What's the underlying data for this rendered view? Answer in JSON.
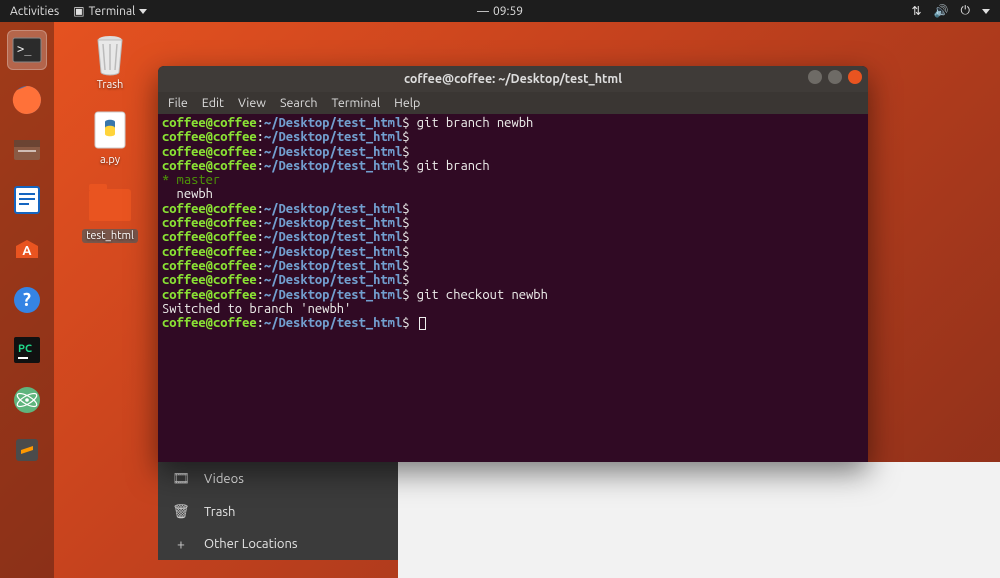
{
  "topbar": {
    "activities": "Activities",
    "app_name": "Terminal",
    "clock": "09:59",
    "clock_prefix": "—"
  },
  "desktop": {
    "trash": "Trash",
    "apy": "a.py",
    "folder": "test_html"
  },
  "nautilus": {
    "videos": "Videos",
    "trash": "Trash",
    "other": "Other Locations"
  },
  "terminal": {
    "title": "coffee@coffee: ~/Desktop/test_html",
    "menu": {
      "file": "File",
      "edit": "Edit",
      "view": "View",
      "search": "Search",
      "terminal": "Terminal",
      "help": "Help"
    },
    "prompt": {
      "user": "coffee@coffee",
      "sep": ":",
      "path": "~/Desktop/test_html",
      "sym": "$"
    },
    "lines": [
      {
        "type": "cmd",
        "text": " git branch newbh"
      },
      {
        "type": "cmd",
        "text": ""
      },
      {
        "type": "cmd",
        "text": ""
      },
      {
        "type": "cmd",
        "text": " git branch"
      },
      {
        "type": "out_master",
        "text": "* master"
      },
      {
        "type": "out",
        "text": "  newbh"
      },
      {
        "type": "cmd",
        "text": ""
      },
      {
        "type": "cmd",
        "text": ""
      },
      {
        "type": "cmd",
        "text": ""
      },
      {
        "type": "cmd",
        "text": ""
      },
      {
        "type": "cmd",
        "text": ""
      },
      {
        "type": "cmd",
        "text": ""
      },
      {
        "type": "cmd",
        "text": " git checkout newbh"
      },
      {
        "type": "out",
        "text": "Switched to branch 'newbh'"
      },
      {
        "type": "cmd_cursor",
        "text": " "
      }
    ]
  }
}
